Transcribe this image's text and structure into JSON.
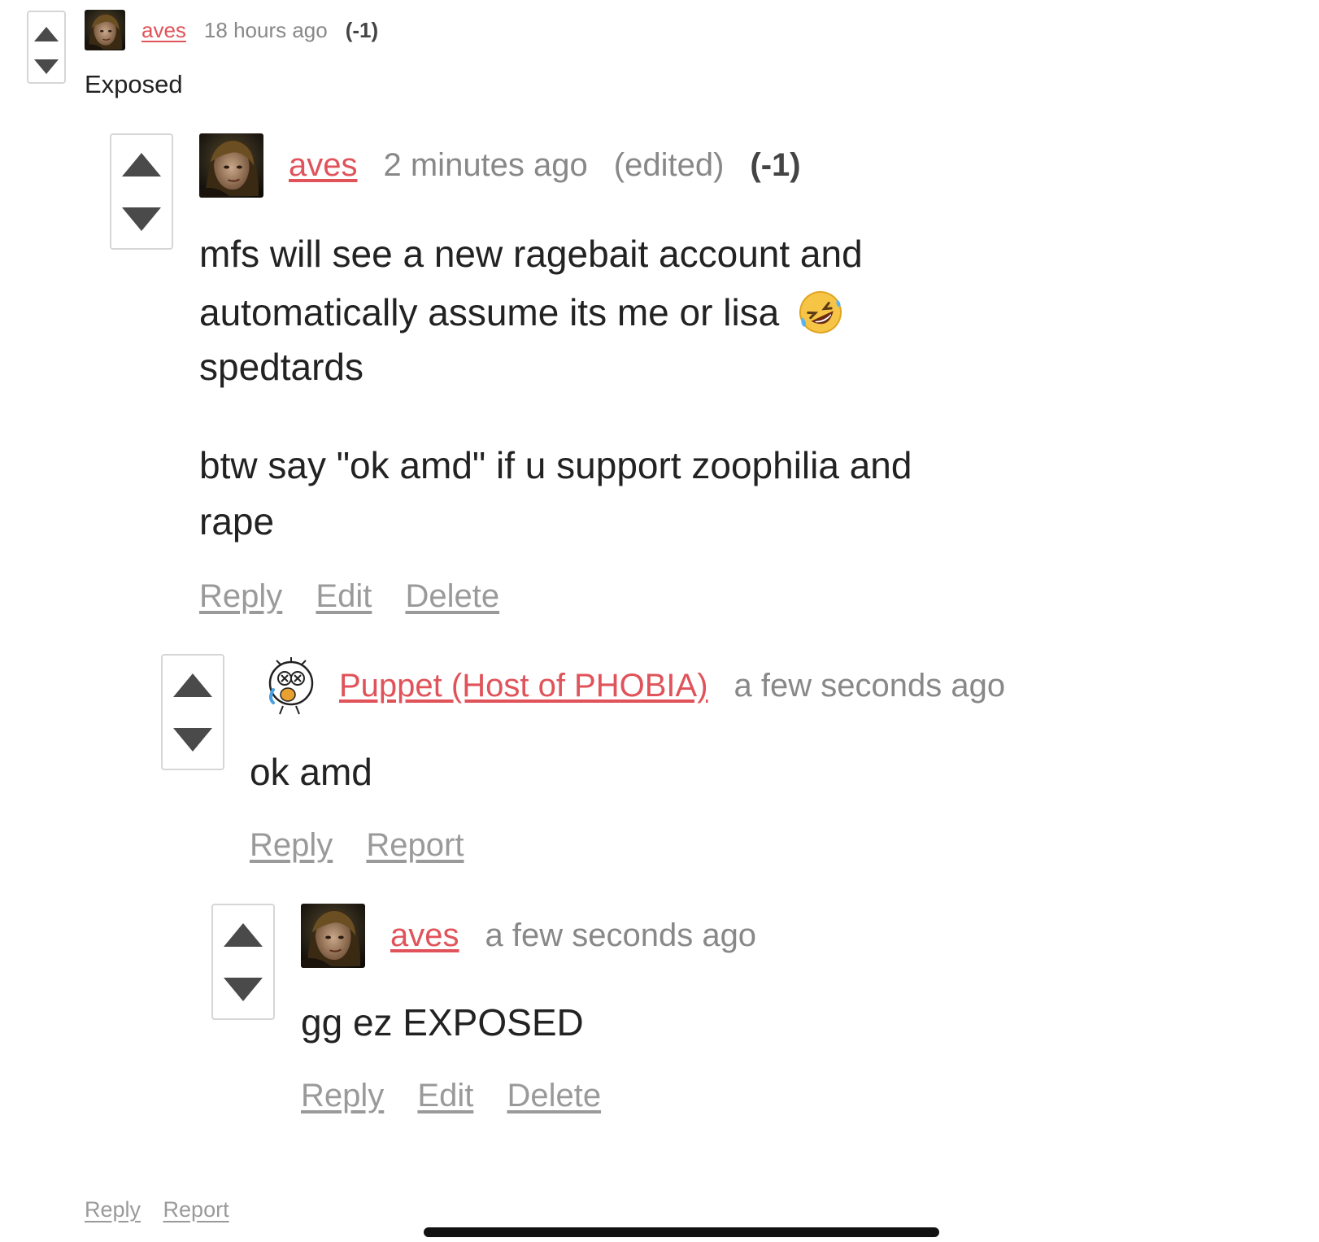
{
  "colors": {
    "author_link": "#e0535a",
    "muted_text": "#888888",
    "action_link": "#9a9a9a",
    "body_text": "#222222",
    "vote_border": "#d6d6d6",
    "vote_arrow": "#4a4a4a"
  },
  "icons": {
    "upvote": "triangle-up",
    "downvote": "triangle-down",
    "emoji": "rolling-on-the-floor-laughing"
  },
  "thread": {
    "top": {
      "author": "aves",
      "time": "18 hours ago",
      "score": "(-1)",
      "body": "Exposed",
      "actions": {
        "reply": "Reply",
        "report": "Report"
      }
    },
    "reply1": {
      "author": "aves",
      "time": "2 minutes ago",
      "edited": "(edited)",
      "score": "(-1)",
      "body": {
        "line1": "mfs will see a new ragebait account and",
        "line2": "automatically assume its me or lisa",
        "line3": "spedtards",
        "line4": "btw say \"ok amd\" if u support zoophilia and",
        "line5": "rape"
      },
      "actions": {
        "reply": "Reply",
        "edit": "Edit",
        "delete": "Delete"
      }
    },
    "reply2": {
      "author": "Puppet (Host of PHOBIA)",
      "time": "a few seconds ago",
      "body": "ok amd",
      "actions": {
        "reply": "Reply",
        "report": "Report"
      }
    },
    "reply3": {
      "author": "aves",
      "time": "a few seconds ago",
      "body": "gg ez EXPOSED",
      "actions": {
        "reply": "Reply",
        "edit": "Edit",
        "delete": "Delete"
      }
    }
  }
}
